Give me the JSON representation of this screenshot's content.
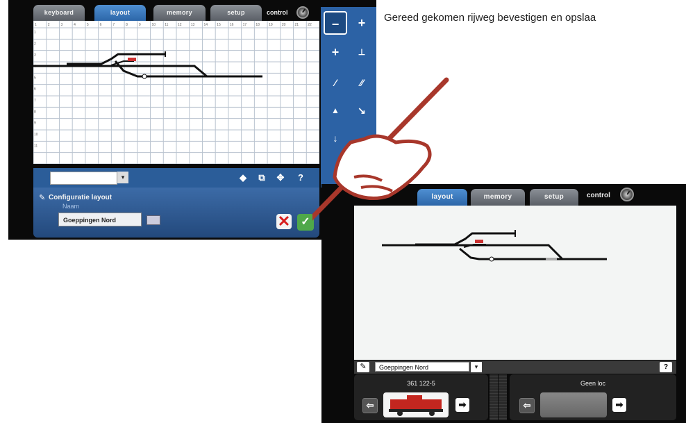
{
  "caption": "Gereed gekomen rijweg bevestigen en opslaa",
  "screen1": {
    "tabs": [
      "keyboard",
      "layout",
      "memory",
      "setup"
    ],
    "active_tab": "layout",
    "control_label": "control",
    "col_numbers": [
      "1",
      "2",
      "3",
      "4",
      "5",
      "6",
      "7",
      "8",
      "9",
      "10",
      "11",
      "12",
      "13",
      "14",
      "15",
      "16",
      "17",
      "18",
      "19",
      "20",
      "21",
      "22"
    ],
    "row_numbers": [
      "1",
      "2",
      "3",
      "4",
      "5",
      "6",
      "7",
      "8",
      "9",
      "10",
      "11"
    ],
    "config_title": "Configuratie layout",
    "name_label": "Naam",
    "name_value": "Goeppingen Nord",
    "toolbar_help": "?",
    "right_panel": {
      "zoom_out": "−",
      "zoom_in": "+"
    }
  },
  "screen2": {
    "tabs": [
      "layout",
      "memory",
      "setup"
    ],
    "active_tab": "layout",
    "control_label": "control",
    "layout_name": "Goeppingen Nord",
    "help": "?",
    "loco_left_name": "361 122-5",
    "loco_right_name": "Geen loc"
  },
  "colors": {
    "accent_blue": "#2c62a5",
    "confirm_green": "#4fa84a",
    "cancel_red": "#d71c1c",
    "pen_red": "#a8372b"
  },
  "icons": [
    "zoom-out-icon",
    "zoom-in-icon",
    "cancel-icon",
    "confirm-icon",
    "keyboard-icon",
    "wrench-icon",
    "arrow-left-icon",
    "arrow-right-icon",
    "help-icon",
    "control-knob-icon",
    "locomotive-icon",
    "pen-hand-icon"
  ]
}
